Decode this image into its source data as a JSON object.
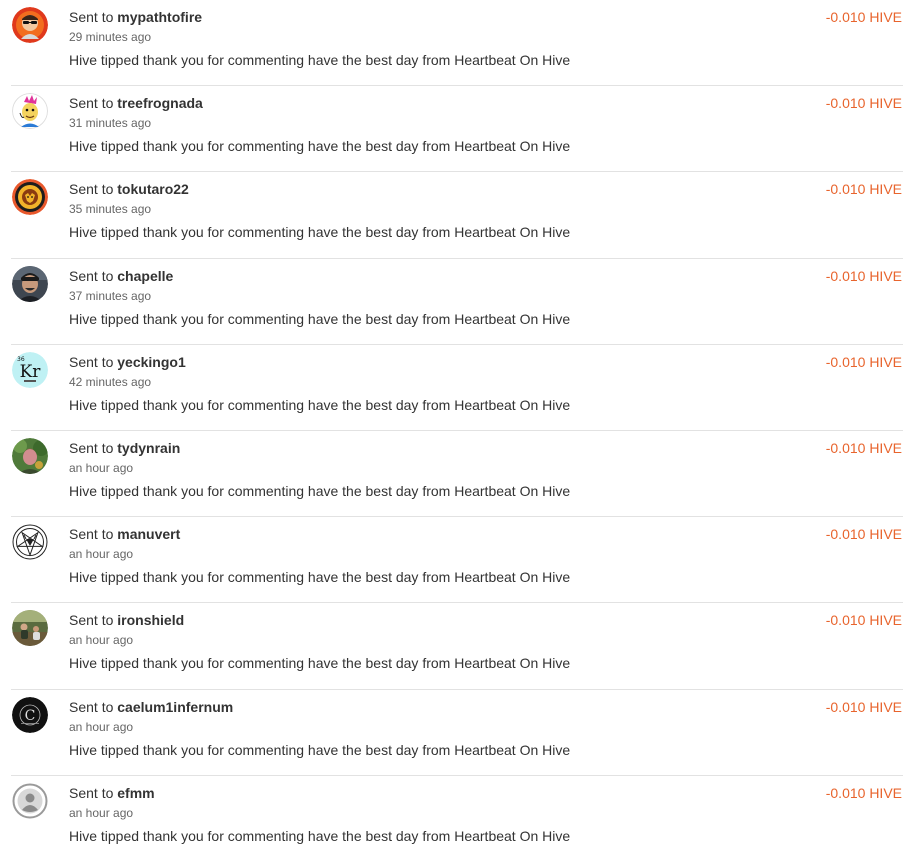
{
  "colors": {
    "amount": "#e8642d",
    "text": "#333333",
    "muted": "#666666",
    "divider": "#e2e2e2"
  },
  "transactions": [
    {
      "prefix": "Sent to",
      "recipient": "mypathtofire",
      "time": "29 minutes ago",
      "memo": "Hive tipped thank you for commenting have the best day from Heartbeat On Hive",
      "amount": "-0.010 HIVE",
      "avatar_icon": "red-avatar-sunglasses-icon"
    },
    {
      "prefix": "Sent to",
      "recipient": "treefrognada",
      "time": "31 minutes ago",
      "memo": "Hive tipped thank you for commenting have the best day from Heartbeat On Hive",
      "amount": "-0.010 HIVE",
      "avatar_icon": "frog-character-avatar-icon"
    },
    {
      "prefix": "Sent to",
      "recipient": "tokutaro22",
      "time": "35 minutes ago",
      "memo": "Hive tipped thank you for commenting have the best day from Heartbeat On Hive",
      "amount": "-0.010 HIVE",
      "avatar_icon": "lion-emblem-avatar-icon"
    },
    {
      "prefix": "Sent to",
      "recipient": "chapelle",
      "time": "37 minutes ago",
      "memo": "Hive tipped thank you for commenting have the best day from Heartbeat On Hive",
      "amount": "-0.010 HIVE",
      "avatar_icon": "person-photo-avatar-icon"
    },
    {
      "prefix": "Sent to",
      "recipient": "yeckingo1",
      "time": "42 minutes ago",
      "memo": "Hive tipped thank you for commenting have the best day from Heartbeat On Hive",
      "amount": "-0.010 HIVE",
      "avatar_icon": "krypton-element-avatar-icon",
      "avatar_text": "Kr"
    },
    {
      "prefix": "Sent to",
      "recipient": "tydynrain",
      "time": "an hour ago",
      "memo": "Hive tipped thank you for commenting have the best day from Heartbeat On Hive",
      "amount": "-0.010 HIVE",
      "avatar_icon": "nature-photo-avatar-icon"
    },
    {
      "prefix": "Sent to",
      "recipient": "manuvert",
      "time": "an hour ago",
      "memo": "Hive tipped thank you for commenting have the best day from Heartbeat On Hive",
      "amount": "-0.010 HIVE",
      "avatar_icon": "pentagram-avatar-icon"
    },
    {
      "prefix": "Sent to",
      "recipient": "ironshield",
      "time": "an hour ago",
      "memo": "Hive tipped thank you for commenting have the best day from Heartbeat On Hive",
      "amount": "-0.010 HIVE",
      "avatar_icon": "outdoor-photo-avatar-icon"
    },
    {
      "prefix": "Sent to",
      "recipient": "caelum1infernum",
      "time": "an hour ago",
      "memo": "Hive tipped thank you for commenting have the best day from Heartbeat On Hive",
      "amount": "-0.010 HIVE",
      "avatar_icon": "dark-logo-avatar-icon",
      "avatar_text": "C"
    },
    {
      "prefix": "Sent to",
      "recipient": "efmm",
      "time": "an hour ago",
      "memo": "Hive tipped thank you for commenting have the best day from Heartbeat On Hive",
      "amount": "-0.010 HIVE",
      "avatar_icon": "default-user-avatar-icon"
    }
  ]
}
